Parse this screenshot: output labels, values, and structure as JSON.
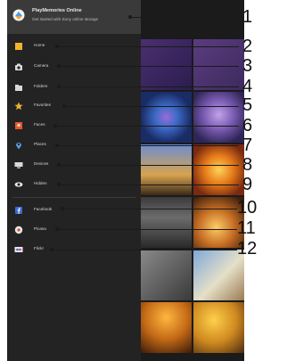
{
  "account": {
    "title": "PlayMemories Online",
    "subtitle": "Get started with Sony online storage"
  },
  "nav": {
    "items": [
      {
        "label": "Home",
        "icon": "home-icon",
        "color": "#f2b22e"
      },
      {
        "label": "Camera",
        "icon": "camera-icon",
        "color": "#d9d9d9"
      },
      {
        "label": "Folders",
        "icon": "folder-icon",
        "color": "#d9d9d9"
      },
      {
        "label": "Favorites",
        "icon": "star-icon",
        "color": "#f2b22e"
      },
      {
        "label": "Faces",
        "icon": "face-icon",
        "color": "#e0582f"
      },
      {
        "label": "Places",
        "icon": "map-pin-icon",
        "color": "#5aa0e6"
      },
      {
        "label": "Devices",
        "icon": "device-icon",
        "color": "#d9d9d9"
      },
      {
        "label": "Hidden",
        "icon": "eye-icon",
        "color": "#e9e9e9"
      }
    ],
    "services": [
      {
        "label": "Facebook",
        "icon": "facebook-icon",
        "color": "#3a6ad1"
      },
      {
        "label": "Picasa",
        "icon": "picasa-icon",
        "color": "#e9e9e9"
      },
      {
        "label": "Flickr",
        "icon": "flickr-icon",
        "color": "#e9e9e9"
      }
    ]
  },
  "callouts": [
    "1",
    "2",
    "3",
    "4",
    "5",
    "6",
    "7",
    "8",
    "9",
    "10",
    "11",
    "12"
  ]
}
